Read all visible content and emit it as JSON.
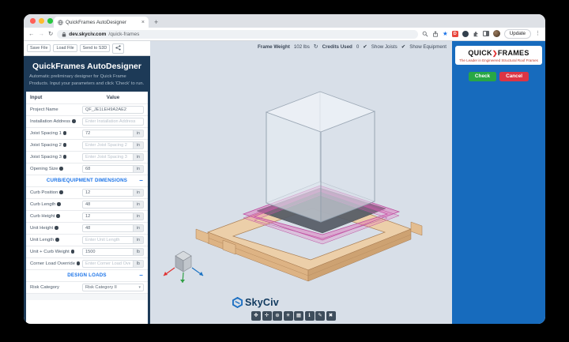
{
  "browser": {
    "tab_title": "QuickFrames AutoDesigner",
    "tab_close": "×",
    "new_tab": "+",
    "nav": {
      "back": "←",
      "forward": "→",
      "reload": "↻"
    },
    "url": {
      "host": "dev.skyciv.com",
      "path": "/quick-frames"
    },
    "star": "★",
    "ext_d": "D",
    "update_label": "Update",
    "menu_dots": "⋮"
  },
  "sidebar": {
    "toolbar": {
      "save": "Save File",
      "load": "Load File",
      "send": "Send to S3D"
    },
    "title": "QuickFrames AutoDesigner",
    "subtitle": "Automatic preliminary designer for Quick Frame Products. Input your parameters and click 'Check' to run.",
    "table_header": {
      "input": "Input",
      "value": "Value"
    },
    "rows": [
      {
        "label": "Project Name",
        "value": "QF_JE1LEH9A2AE2"
      },
      {
        "label": "Installation Address",
        "placeholder": "Enter Installation Address"
      },
      {
        "label": "Joist Spacing 1",
        "value": "72",
        "unit": "in"
      },
      {
        "label": "Joist Spacing 2",
        "placeholder": "Enter Joist Spacing 2",
        "unit": "in"
      },
      {
        "label": "Joist Spacing 3",
        "placeholder": "Enter Joist Spacing 3",
        "unit": "in"
      },
      {
        "label": "Opening Size",
        "value": "68",
        "unit": "in"
      }
    ],
    "section_curb": {
      "title": "CURB/EQUIPMENT DIMENSIONS",
      "collapse": "−"
    },
    "curb_rows": [
      {
        "label": "Curb Position",
        "value": "12",
        "unit": "in"
      },
      {
        "label": "Curb Length",
        "value": "48",
        "unit": "in"
      },
      {
        "label": "Curb Height",
        "value": "12",
        "unit": "in"
      },
      {
        "label": "Unit Height",
        "value": "48",
        "unit": "in"
      },
      {
        "label": "Unit Length",
        "placeholder": "Enter Unit Length",
        "unit": "in"
      },
      {
        "label": "Unit + Curb Weight",
        "value": "1500",
        "unit": "lb"
      },
      {
        "label": "Corner Load Override",
        "placeholder": "Enter Corner Load Override",
        "unit": "lb"
      }
    ],
    "section_loads": {
      "title": "DESIGN LOADS",
      "collapse": "−"
    },
    "risk_row": {
      "label": "Risk Category",
      "value": "Risk Category II",
      "caret": "▾"
    }
  },
  "viewport": {
    "status": {
      "frame_weight_label": "Frame Weight",
      "frame_weight_value": "102 lbs",
      "credits_icon": "↻",
      "credits_label": "Credits Used",
      "credits_value": "0",
      "check_glyph": "✔",
      "show_joists": "Show Joists",
      "show_equipment": "Show Equipment"
    },
    "skyciv_logo": "SkyCiv",
    "tools": [
      {
        "name": "pan",
        "glyph": "✥"
      },
      {
        "name": "move",
        "glyph": "✛"
      },
      {
        "name": "zoom-fit",
        "glyph": "⊕"
      },
      {
        "name": "light",
        "glyph": "☀"
      },
      {
        "name": "views",
        "glyph": "▦"
      },
      {
        "name": "info",
        "glyph": "ℹ"
      },
      {
        "name": "annotate",
        "glyph": "✎"
      },
      {
        "name": "delete",
        "glyph": "✖"
      }
    ]
  },
  "panel": {
    "logo_quick": "QUICK",
    "logo_arrow": "❯",
    "logo_frames": "FRAMES",
    "tagline": "The Leader in Engineered Structural Roof Frames",
    "check_label": "Check",
    "cancel_label": "Cancel"
  },
  "colors": {
    "sidebar_bg": "#1d3a57",
    "panel_bg": "#176bbd",
    "accent_blue": "#1a73e8",
    "check_green": "#28a745",
    "cancel_red": "#dc3545",
    "viewport_bg": "#d8dfe8",
    "wood": "#eccfa9",
    "pink_frame": "#c2519e"
  }
}
